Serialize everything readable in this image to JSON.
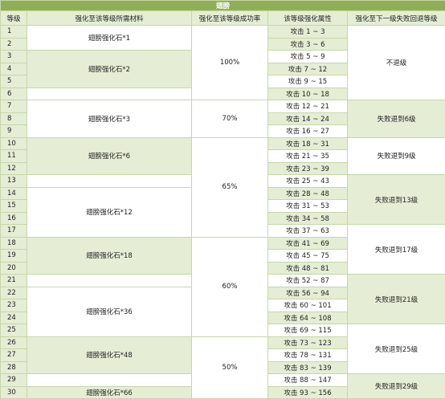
{
  "title": "翅膀",
  "headers": [
    "等级",
    "强化至该等级所需材料",
    "强化至该等级成功率",
    "该等级强化属性",
    "强化至下一级失败回退等级"
  ],
  "levels": [
    "1",
    "2",
    "3",
    "4",
    "5",
    "6",
    "7",
    "8",
    "9",
    "10",
    "11",
    "12",
    "13",
    "14",
    "15",
    "16",
    "17",
    "18",
    "19",
    "20",
    "21",
    "22",
    "23",
    "24",
    "25",
    "26",
    "27",
    "28",
    "29",
    "30"
  ],
  "materials": [
    "翅膀强化石*1",
    "翅膀强化石*2",
    "翅膀强化石*3",
    "翅膀强化石*6",
    "翅膀强化石*12",
    "翅膀强化石*18",
    "翅膀强化石*36",
    "翅膀强化石*48",
    "翅膀强化石*66"
  ],
  "rates": [
    "100%",
    "70%",
    "65%",
    "60%",
    "50%"
  ],
  "attributes": [
    "攻击 1 ~ 3",
    "攻击 3 ~ 6",
    "攻击 5 ~ 9",
    "攻击 7 ~ 12",
    "攻击 9 ~ 15",
    "攻击 10 ~ 18",
    "攻击 12 ~ 21",
    "攻击 14 ~ 24",
    "攻击 16 ~ 27",
    "攻击 18 ~ 31",
    "攻击 21 ~ 35",
    "攻击 23 ~ 39",
    "攻击 25 ~ 43",
    "攻击 28 ~ 48",
    "攻击 31 ~ 53",
    "攻击 34 ~ 58",
    "攻击 37 ~ 63",
    "攻击 41 ~ 69",
    "攻击 45 ~ 75",
    "攻击 48 ~ 81",
    "攻击 52 ~ 87",
    "攻击 56 ~ 94",
    "攻击 60 ~ 101",
    "攻击 64 ~ 108",
    "攻击 69 ~ 115",
    "攻击 73 ~ 123",
    "攻击 78 ~ 131",
    "攻击 83 ~ 139",
    "攻击 88 ~ 147",
    "攻击 93 ~ 156"
  ],
  "fallbacks": [
    "不退级",
    "失败退到6级",
    "失败退到9级",
    "失败退到13级",
    "失败退到17级",
    "失败退到21级",
    "失败退到25级",
    "失败退到29级"
  ],
  "colors": {
    "title_bg": "#8fae55",
    "alt_bg": "#e5edd5",
    "border": "#c6d7a9"
  }
}
